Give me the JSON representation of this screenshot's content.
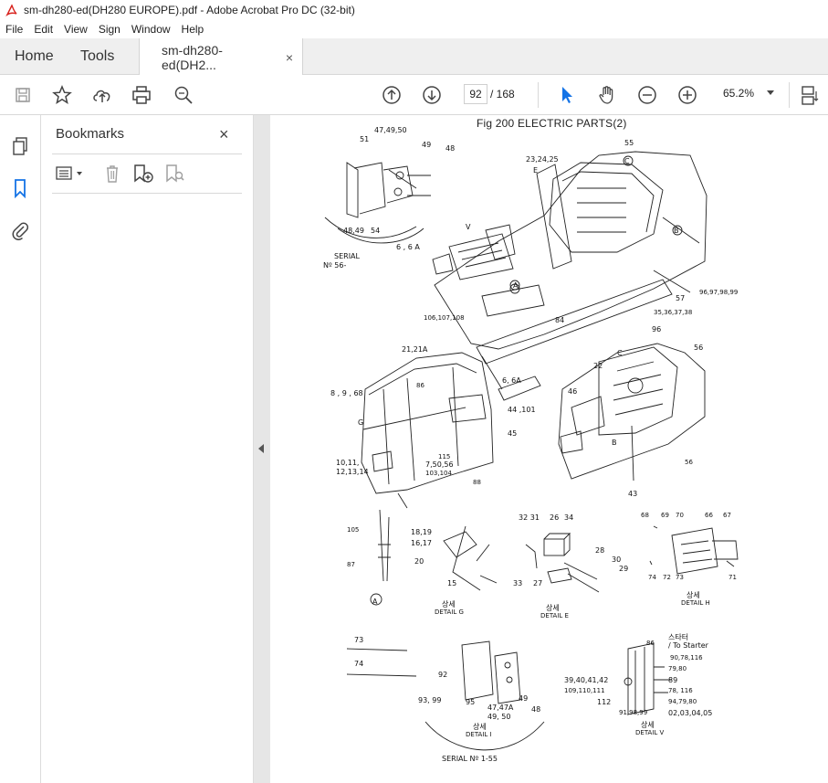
{
  "window": {
    "title": "sm-dh280-ed(DH280 EUROPE).pdf - Adobe Acrobat Pro DC (32-bit)"
  },
  "menu": [
    "File",
    "Edit",
    "View",
    "Sign",
    "Window",
    "Help"
  ],
  "tabs": {
    "home": "Home",
    "tools": "Tools",
    "doc": "sm-dh280-ed(DH2...",
    "close": "×"
  },
  "toolbar": {
    "page_current": "92",
    "page_total": "/  168",
    "zoom": "65.2%"
  },
  "bookmarks": {
    "title": "Bookmarks",
    "close": "×"
  },
  "colors": {
    "accent": "#1473e6",
    "acrobat_red": "#d8231e"
  },
  "page": {
    "title": "Fig 200 ELECTRIC PARTS(2)",
    "labels": [
      {
        "t": "47,49,50"
      },
      {
        "t": "51"
      },
      {
        "t": "49"
      },
      {
        "t": "48"
      },
      {
        "t": "48,49"
      },
      {
        "t": "54"
      },
      {
        "t": "SERIAL"
      },
      {
        "t": "Nº 56-"
      },
      {
        "t": "23,24,25"
      },
      {
        "t": "E"
      },
      {
        "t": "55"
      },
      {
        "t": "C"
      },
      {
        "t": "B"
      },
      {
        "t": "6 , 6 A"
      },
      {
        "t": "V"
      },
      {
        "t": "A"
      },
      {
        "t": "57"
      },
      {
        "t": "96,97,98,99"
      },
      {
        "t": "35,36,37,38"
      },
      {
        "t": "84"
      },
      {
        "t": "106,107,108"
      },
      {
        "t": "6, 6A"
      },
      {
        "t": "21,21A"
      },
      {
        "t": "96"
      },
      {
        "t": "56"
      },
      {
        "t": "C"
      },
      {
        "t": "22"
      },
      {
        "t": "46"
      },
      {
        "t": "8 , 9 , 68"
      },
      {
        "t": "86"
      },
      {
        "t": "44 ,101"
      },
      {
        "t": "45"
      },
      {
        "t": "G"
      },
      {
        "t": "B"
      },
      {
        "t": "56"
      },
      {
        "t": "10,11,"
      },
      {
        "t": "12,13,14"
      },
      {
        "t": "115"
      },
      {
        "t": "7,50,56"
      },
      {
        "t": "103,104"
      },
      {
        "t": "88"
      },
      {
        "t": "43"
      },
      {
        "t": "32 31"
      },
      {
        "t": "26"
      },
      {
        "t": "34"
      },
      {
        "t": "68"
      },
      {
        "t": "69"
      },
      {
        "t": "70"
      },
      {
        "t": "66"
      },
      {
        "t": "67"
      },
      {
        "t": "105"
      },
      {
        "t": "18,19"
      },
      {
        "t": "16,17"
      },
      {
        "t": "20"
      },
      {
        "t": "87"
      },
      {
        "t": "15"
      },
      {
        "t": "28"
      },
      {
        "t": "30"
      },
      {
        "t": "29"
      },
      {
        "t": "33"
      },
      {
        "t": "27"
      },
      {
        "t": "74"
      },
      {
        "t": "72"
      },
      {
        "t": "73"
      },
      {
        "t": "71"
      },
      {
        "t": "A"
      },
      {
        "t": "상세"
      },
      {
        "t": "DETAIL  G"
      },
      {
        "t": "상세"
      },
      {
        "t": "DETAIL  E"
      },
      {
        "t": "상세"
      },
      {
        "t": "DETAIL  H"
      },
      {
        "t": "73"
      },
      {
        "t": "74"
      },
      {
        "t": "92"
      },
      {
        "t": "93, 99"
      },
      {
        "t": "95"
      },
      {
        "t": "47,47A"
      },
      {
        "t": "49, 50"
      },
      {
        "t": "49"
      },
      {
        "t": "48"
      },
      {
        "t": "상세"
      },
      {
        "t": "DETAIL  I"
      },
      {
        "t": "SERIAL  Nº 1-55"
      },
      {
        "t": "86"
      },
      {
        "t": "스타터"
      },
      {
        "t": "/ To Starter"
      },
      {
        "t": "90,78,116"
      },
      {
        "t": "79,80"
      },
      {
        "t": "89"
      },
      {
        "t": "39,40,41,42"
      },
      {
        "t": "109,110,111"
      },
      {
        "t": "78, 116"
      },
      {
        "t": "112"
      },
      {
        "t": "94,79,80"
      },
      {
        "t": "91,98,99"
      },
      {
        "t": "02,03,04,05"
      },
      {
        "t": "상세"
      },
      {
        "t": "DETAIL  V"
      }
    ]
  }
}
